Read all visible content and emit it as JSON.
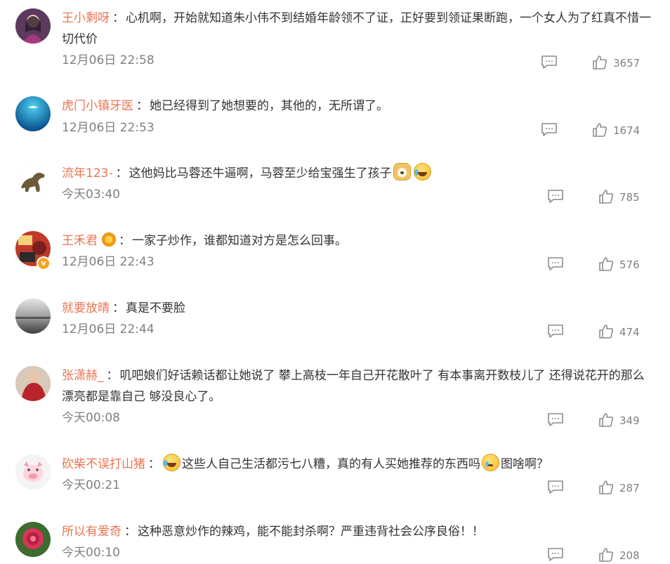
{
  "comments": [
    {
      "username": "王小剩呀",
      "text": "心机啊，开始就知道朱小伟不到结婚年龄领不了证，正好要到领证果断跑，一个女人为了红真不惜一切代价",
      "time": "12月06日 22:58",
      "likes": "3657",
      "avatar": "woman-purple-avatar"
    },
    {
      "username": "虎门小镇牙医",
      "text": "她已经得到了她想要的，其他的，无所谓了。",
      "time": "12月06日 22:53",
      "likes": "1674",
      "avatar": "ocean-avatar"
    },
    {
      "username": "流年123-",
      "text": "这他妈比马蓉还牛逼啊，马蓉至少给宝强生了孩子",
      "time": "今天03:40",
      "likes": "785",
      "avatar": "dinosaur-avatar",
      "emojis": [
        "dog-emoji",
        "laugh-cry-emoji"
      ]
    },
    {
      "username": "王禾君",
      "text": "一家子炒作，谁都知道对方是怎么回事。",
      "time": "12月06日 22:43",
      "likes": "576",
      "avatar": "red-poster-avatar",
      "verified": true
    },
    {
      "username": "就要放晴",
      "text": "真是不要脸",
      "time": "12月06日 22:44",
      "likes": "474",
      "avatar": "grey-sky-avatar"
    },
    {
      "username": "张潇赫_",
      "text": "叽吧娘们好话赖话都让她说了 攀上高枝一年自己开花散叶了 有本事离开数枝儿了 还得说花开的那么漂亮都是靠自己 够没良心了。",
      "time": "今天00:08",
      "likes": "349",
      "avatar": "red-dress-avatar"
    },
    {
      "username": "砍柴不误打山猪",
      "text_a": "这些人自己生活都污七八糟，真的有人买她推荐的东西吗",
      "text_b": "图啥啊？",
      "time": "今天00:21",
      "likes": "287",
      "avatar": "pig-avatar",
      "emojis": [
        "laugh-cry-emoji",
        "sweat-emoji"
      ]
    },
    {
      "username": "所以有爱奇",
      "text": "这种恶意炒作的辣鸡，能不能封杀啊？严重违背社会公序良俗！！",
      "time": "今天00:10",
      "likes": "208",
      "avatar": "rose-avatar"
    }
  ],
  "colors": {
    "username": "#eb7350",
    "text": "#333333",
    "meta": "#808080"
  }
}
